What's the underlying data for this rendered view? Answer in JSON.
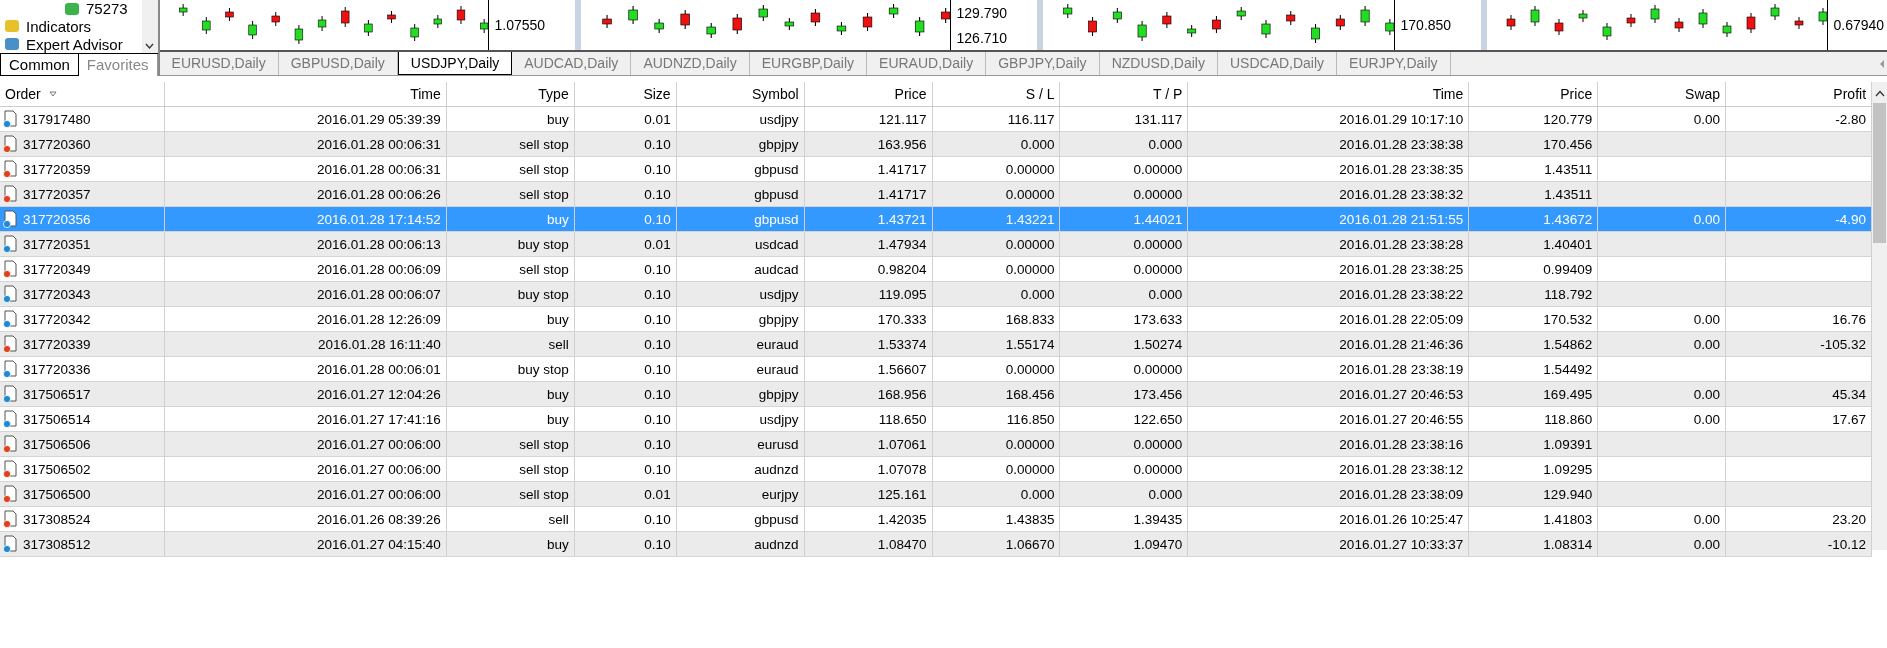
{
  "navigator": {
    "items": [
      {
        "label": "75273",
        "kind": "account"
      },
      {
        "label": "Indicators",
        "kind": "indicators"
      },
      {
        "label": "Expert Advisor",
        "kind": "experts"
      }
    ],
    "tabs": [
      {
        "label": "Common",
        "selected": true
      },
      {
        "label": "Favorites",
        "selected": false
      }
    ]
  },
  "charts": [
    {
      "price_labels": [
        "1.07550"
      ]
    },
    {
      "price_labels": [
        "129.790",
        "126.710"
      ]
    },
    {
      "price_labels": [
        "170.850"
      ]
    },
    {
      "price_labels": [
        "0.67940"
      ]
    }
  ],
  "chart_tabs": [
    {
      "label": "EURUSD,Daily",
      "selected": false
    },
    {
      "label": "GBPUSD,Daily",
      "selected": false
    },
    {
      "label": "USDJPY,Daily",
      "selected": true
    },
    {
      "label": "AUDCAD,Daily",
      "selected": false
    },
    {
      "label": "AUDNZD,Daily",
      "selected": false
    },
    {
      "label": "EURGBP,Daily",
      "selected": false
    },
    {
      "label": "EURAUD,Daily",
      "selected": false
    },
    {
      "label": "GBPJPY,Daily",
      "selected": false
    },
    {
      "label": "NZDUSD,Daily",
      "selected": false
    },
    {
      "label": "USDCAD,Daily",
      "selected": false
    },
    {
      "label": "EURJPY,Daily",
      "selected": false
    }
  ],
  "table": {
    "columns": [
      "Order",
      "Time",
      "Type",
      "Size",
      "Symbol",
      "Price",
      "S / L",
      "T / P",
      "Time",
      "Price",
      "Swap",
      "Profit"
    ],
    "rows": [
      {
        "kind": "buy",
        "selected": false,
        "cells": [
          "317917480",
          "2016.01.29 05:39:39",
          "buy",
          "0.01",
          "usdjpy",
          "121.117",
          "116.117",
          "131.117",
          "2016.01.29 10:17:10",
          "120.779",
          "0.00",
          "-2.80"
        ]
      },
      {
        "kind": "sell",
        "selected": false,
        "cells": [
          "317720360",
          "2016.01.28 00:06:31",
          "sell stop",
          "0.10",
          "gbpjpy",
          "163.956",
          "0.000",
          "0.000",
          "2016.01.28 23:38:38",
          "170.456"
        ]
      },
      {
        "kind": "sell",
        "selected": false,
        "cells": [
          "317720359",
          "2016.01.28 00:06:31",
          "sell stop",
          "0.10",
          "gbpusd",
          "1.41717",
          "0.00000",
          "0.00000",
          "2016.01.28 23:38:35",
          "1.43511"
        ]
      },
      {
        "kind": "sell",
        "selected": false,
        "cells": [
          "317720357",
          "2016.01.28 00:06:26",
          "sell stop",
          "0.10",
          "gbpusd",
          "1.41717",
          "0.00000",
          "0.00000",
          "2016.01.28 23:38:32",
          "1.43511"
        ]
      },
      {
        "kind": "buy",
        "selected": true,
        "cells": [
          "317720356",
          "2016.01.28 17:14:52",
          "buy",
          "0.10",
          "gbpusd",
          "1.43721",
          "1.43221",
          "1.44021",
          "2016.01.28 21:51:55",
          "1.43672",
          "0.00",
          "-4.90"
        ]
      },
      {
        "kind": "buy",
        "selected": false,
        "cells": [
          "317720351",
          "2016.01.28 00:06:13",
          "buy stop",
          "0.01",
          "usdcad",
          "1.47934",
          "0.00000",
          "0.00000",
          "2016.01.28 23:38:28",
          "1.40401"
        ]
      },
      {
        "kind": "sell",
        "selected": false,
        "cells": [
          "317720349",
          "2016.01.28 00:06:09",
          "sell stop",
          "0.10",
          "audcad",
          "0.98204",
          "0.00000",
          "0.00000",
          "2016.01.28 23:38:25",
          "0.99409"
        ]
      },
      {
        "kind": "buy",
        "selected": false,
        "cells": [
          "317720343",
          "2016.01.28 00:06:07",
          "buy stop",
          "0.10",
          "usdjpy",
          "119.095",
          "0.000",
          "0.000",
          "2016.01.28 23:38:22",
          "118.792"
        ]
      },
      {
        "kind": "buy",
        "selected": false,
        "cells": [
          "317720342",
          "2016.01.28 12:26:09",
          "buy",
          "0.10",
          "gbpjpy",
          "170.333",
          "168.833",
          "173.633",
          "2016.01.28 22:05:09",
          "170.532",
          "0.00",
          "16.76"
        ]
      },
      {
        "kind": "sell",
        "selected": false,
        "cells": [
          "317720339",
          "2016.01.28 16:11:40",
          "sell",
          "0.10",
          "euraud",
          "1.53374",
          "1.55174",
          "1.50274",
          "2016.01.28 21:46:36",
          "1.54862",
          "0.00",
          "-105.32"
        ]
      },
      {
        "kind": "buy",
        "selected": false,
        "cells": [
          "317720336",
          "2016.01.28 00:06:01",
          "buy stop",
          "0.10",
          "euraud",
          "1.56607",
          "0.00000",
          "0.00000",
          "2016.01.28 23:38:19",
          "1.54492"
        ]
      },
      {
        "kind": "buy",
        "selected": false,
        "cells": [
          "317506517",
          "2016.01.27 12:04:26",
          "buy",
          "0.10",
          "gbpjpy",
          "168.956",
          "168.456",
          "173.456",
          "2016.01.27 20:46:53",
          "169.495",
          "0.00",
          "45.34"
        ]
      },
      {
        "kind": "buy",
        "selected": false,
        "cells": [
          "317506514",
          "2016.01.27 17:41:16",
          "buy",
          "0.10",
          "usdjpy",
          "118.650",
          "116.850",
          "122.650",
          "2016.01.27 20:46:55",
          "118.860",
          "0.00",
          "17.67"
        ]
      },
      {
        "kind": "sell",
        "selected": false,
        "cells": [
          "317506506",
          "2016.01.27 00:06:00",
          "sell stop",
          "0.10",
          "eurusd",
          "1.07061",
          "0.00000",
          "0.00000",
          "2016.01.28 23:38:16",
          "1.09391"
        ]
      },
      {
        "kind": "sell",
        "selected": false,
        "cells": [
          "317506502",
          "2016.01.27 00:06:00",
          "sell stop",
          "0.10",
          "audnzd",
          "1.07078",
          "0.00000",
          "0.00000",
          "2016.01.28 23:38:12",
          "1.09295"
        ]
      },
      {
        "kind": "sell",
        "selected": false,
        "cells": [
          "317506500",
          "2016.01.27 00:06:00",
          "sell stop",
          "0.01",
          "eurjpy",
          "125.161",
          "0.000",
          "0.000",
          "2016.01.28 23:38:09",
          "129.940"
        ]
      },
      {
        "kind": "sell",
        "selected": false,
        "cells": [
          "317308524",
          "2016.01.26 08:39:26",
          "sell",
          "0.10",
          "gbpusd",
          "1.42035",
          "1.43835",
          "1.39435",
          "2016.01.26 10:25:47",
          "1.41803",
          "0.00",
          "23.20"
        ]
      },
      {
        "kind": "buy",
        "selected": false,
        "cells": [
          "317308512",
          "2016.01.27 04:15:40",
          "buy",
          "0.10",
          "audnzd",
          "1.08470",
          "1.06670",
          "1.09470",
          "2016.01.27 10:33:37",
          "1.08314",
          "0.00",
          "-10.12"
        ]
      }
    ]
  }
}
